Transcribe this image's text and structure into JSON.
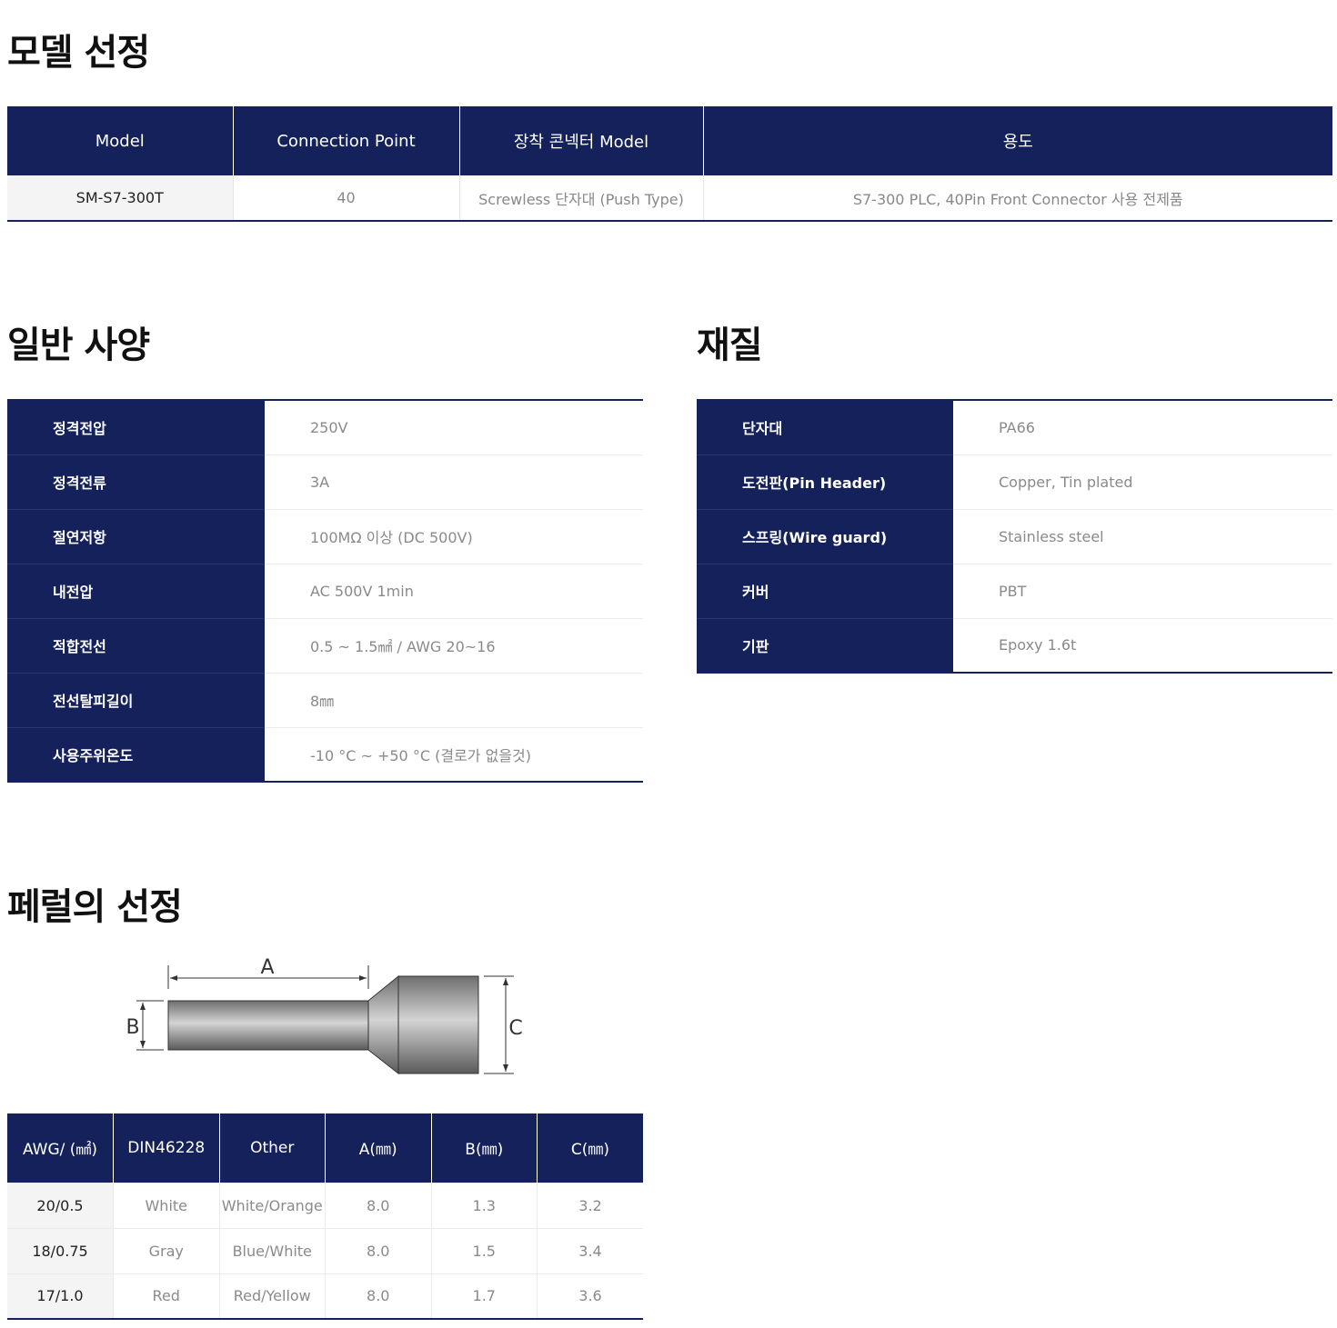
{
  "sections": {
    "model": "모델 선정",
    "general": "일반 사양",
    "material": "재질",
    "ferrule": "페럴의 선정"
  },
  "model_table": {
    "headers": [
      "Model",
      "Connection Point",
      "장착 콘넥터 Model",
      "용도"
    ],
    "row": [
      "SM-S7-300T",
      "40",
      "Screwless 단자대 (Push Type)",
      "S7-300 PLC, 40Pin Front Connector 사용 전제품"
    ]
  },
  "general_specs": [
    {
      "k": "정격전압",
      "v": "250V"
    },
    {
      "k": "정격전류",
      "v": "3A"
    },
    {
      "k": "절연저항",
      "v": "100MΩ 이상 (DC 500V)"
    },
    {
      "k": "내전압",
      "v": "AC 500V 1min"
    },
    {
      "k": "적합전선",
      "v": "0.5 ~ 1.5㎟ / AWG 20~16"
    },
    {
      "k": "전선탈피길이",
      "v": "8㎜"
    },
    {
      "k": "사용주위온도",
      "v": "-10 °C ~ +50 °C (결로가 없을것)"
    }
  ],
  "material_specs": [
    {
      "k": "단자대",
      "v": "PA66"
    },
    {
      "k": "도전판(Pin Header)",
      "v": "Copper, Tin plated"
    },
    {
      "k": "스프링(Wire guard)",
      "v": "Stainless steel"
    },
    {
      "k": "커버",
      "v": "PBT"
    },
    {
      "k": "기판",
      "v": "Epoxy 1.6t"
    }
  ],
  "diagram_labels": {
    "a": "A",
    "b": "B",
    "c": "C"
  },
  "ferrule_table": {
    "headers": [
      "AWG/ (㎟)",
      "DIN46228",
      "Other",
      "A(㎜)",
      "B(㎜)",
      "C(㎜)"
    ],
    "rows": [
      [
        "20/0.5",
        "White",
        "White/Orange",
        "8.0",
        "1.3",
        "3.2"
      ],
      [
        "18/0.75",
        "Gray",
        "Blue/White",
        "8.0",
        "1.5",
        "3.4"
      ],
      [
        "17/1.0",
        "Red",
        "Red/Yellow",
        "8.0",
        "1.7",
        "3.6"
      ]
    ]
  },
  "colors": {
    "navy": "#14215a"
  }
}
